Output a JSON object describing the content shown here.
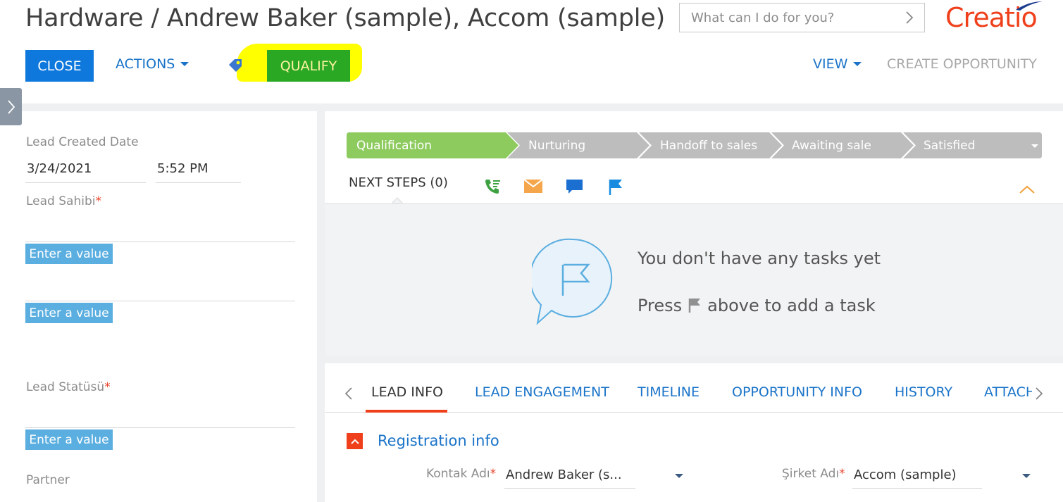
{
  "header": {
    "title": "Hardware / Andrew Baker (sample), Accom (sample)",
    "search_placeholder": "What can I do for you?",
    "logo_text": "Creatio",
    "close_label": "CLOSE",
    "actions_label": "ACTIONS",
    "qualify_label": "QUALIFY",
    "view_label": "VIEW",
    "create_opportunity_label": "CREATE OPPORTUNITY"
  },
  "left_panel": {
    "created_date_label": "Lead Created Date",
    "created_date": "3/24/2021",
    "created_time": "5:52 PM",
    "owner_label": "Lead Sahibi",
    "enter_value_1": "Enter a value",
    "enter_value_2": "Enter a value",
    "status_label": "Lead Statüsü",
    "enter_value_3": "Enter a value",
    "partner_label": "Partner"
  },
  "stages": [
    {
      "label": "Qualification",
      "active": true
    },
    {
      "label": "Nurturing",
      "active": false
    },
    {
      "label": "Handoff to sales",
      "active": false
    },
    {
      "label": "Awaiting sale",
      "active": false
    },
    {
      "label": "Satisfied",
      "active": false
    }
  ],
  "next_steps": {
    "label": "NEXT STEPS (0)",
    "empty_title": "You don't have any tasks yet",
    "hint_before": "Press",
    "hint_after": "above to add a task"
  },
  "tabs": [
    {
      "label": "LEAD INFO",
      "active": true
    },
    {
      "label": "LEAD ENGAGEMENT",
      "active": false
    },
    {
      "label": "TIMELINE",
      "active": false
    },
    {
      "label": "OPPORTUNITY INFO",
      "active": false
    },
    {
      "label": "HISTORY",
      "active": false
    },
    {
      "label": "ATTACH",
      "active": false
    }
  ],
  "registration": {
    "section_title": "Registration info",
    "contact_label": "Kontak Adı",
    "contact_value": "Andrew Baker (s...",
    "company_label": "Şirket Adı",
    "company_value": "Accom (sample)"
  },
  "colors": {
    "accent_blue": "#0e78dc",
    "link_blue": "#1a73c8",
    "qualify_green": "#2aa824",
    "stage_active": "#8dcb5e",
    "stage_inactive": "#bdbdbd",
    "brand_red": "#ef3f1b",
    "highlight_yellow": "#ffff00"
  }
}
